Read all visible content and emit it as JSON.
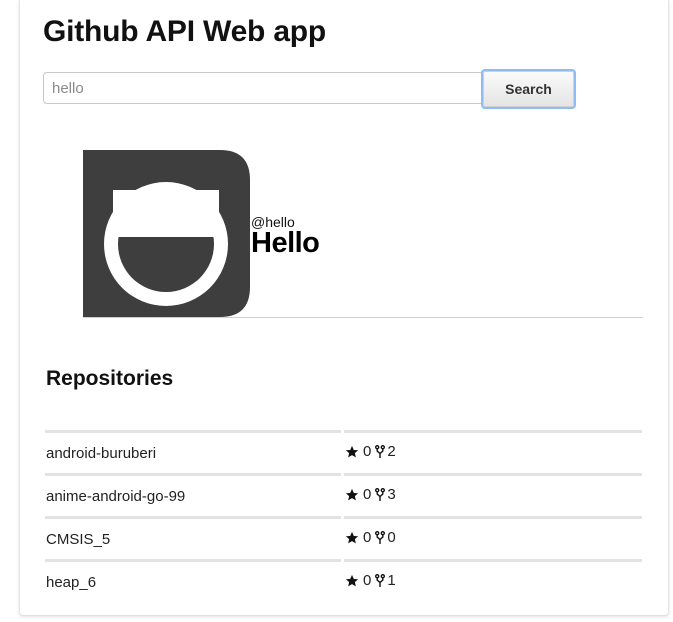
{
  "app": {
    "title": "Github API Web app"
  },
  "search": {
    "value": "hello",
    "button_label": "Search"
  },
  "profile": {
    "username": "@hello",
    "display_name": "Hello",
    "avatar_icon": "smile-face-icon",
    "avatar_colors": {
      "background": "#3f3e3e",
      "face": "#ffffff"
    }
  },
  "repositories": {
    "heading": "Repositories",
    "items": [
      {
        "name": "android-buruberi",
        "stars": "0",
        "forks": "2"
      },
      {
        "name": "anime-android-go-99",
        "stars": "0",
        "forks": "3"
      },
      {
        "name": "CMSIS_5",
        "stars": "0",
        "forks": "0"
      },
      {
        "name": "heap_6",
        "stars": "0",
        "forks": "1"
      }
    ]
  }
}
